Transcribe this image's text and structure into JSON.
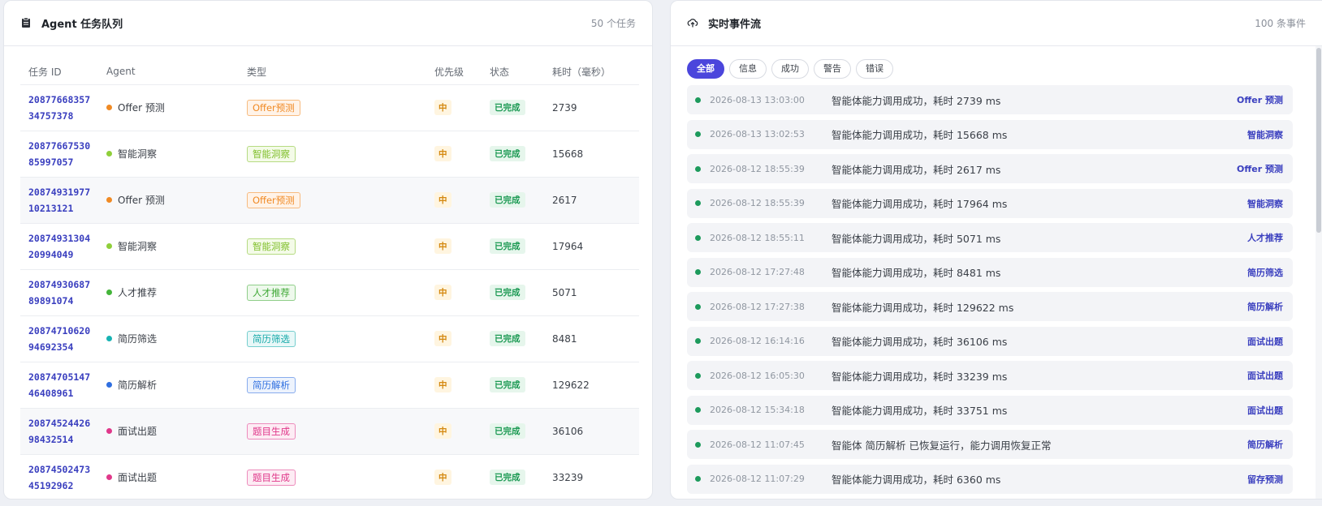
{
  "task_panel": {
    "title": "Agent 任务队列",
    "count": "50 个任务",
    "columns": [
      "任务 ID",
      "Agent",
      "类型",
      "优先级",
      "状态",
      "耗时（毫秒）"
    ],
    "rows": [
      {
        "id": "2087766835734757378",
        "agent": "Offer 预测",
        "agent_color": "#f08a24",
        "type": "Offer预测",
        "type_color": "#f08a24",
        "type_bg": "#fff3e8",
        "priority": "中",
        "status": "已完成",
        "duration": "2739"
      },
      {
        "id": "2087766753085997057",
        "agent": "智能洞察",
        "agent_color": "#8fcf3a",
        "type": "智能洞察",
        "type_color": "#7fbf2a",
        "type_bg": "#f4fbe8",
        "priority": "中",
        "status": "已完成",
        "duration": "15668"
      },
      {
        "id": "2087493197710213121",
        "agent": "Offer 预测",
        "agent_color": "#f08a24",
        "type": "Offer预测",
        "type_color": "#f08a24",
        "type_bg": "#fff3e8",
        "priority": "中",
        "status": "已完成",
        "duration": "2617"
      },
      {
        "id": "2087493130420994049",
        "agent": "智能洞察",
        "agent_color": "#8fcf3a",
        "type": "智能洞察",
        "type_color": "#7fbf2a",
        "type_bg": "#f4fbe8",
        "priority": "中",
        "status": "已完成",
        "duration": "17964"
      },
      {
        "id": "2087493068789891074",
        "agent": "人才推荐",
        "agent_color": "#44b53a",
        "type": "人才推荐",
        "type_color": "#3ea835",
        "type_bg": "#eef9ec",
        "priority": "中",
        "status": "已完成",
        "duration": "5071"
      },
      {
        "id": "2087471062094692354",
        "agent": "简历筛选",
        "agent_color": "#17b3b3",
        "type": "简历筛选",
        "type_color": "#13a8a8",
        "type_bg": "#e8f8f8",
        "priority": "中",
        "status": "已完成",
        "duration": "8481"
      },
      {
        "id": "2087470514746408961",
        "agent": "简历解析",
        "agent_color": "#2f6fe0",
        "type": "简历解析",
        "type_color": "#2f6fe0",
        "type_bg": "#edf3fd",
        "priority": "中",
        "status": "已完成",
        "duration": "129622"
      },
      {
        "id": "2087452442698432514",
        "agent": "面试出题",
        "agent_color": "#e0388a",
        "type": "题目生成",
        "type_color": "#e0388a",
        "type_bg": "#fdecf4",
        "priority": "中",
        "status": "已完成",
        "duration": "36106"
      },
      {
        "id": "2087450247345192962",
        "agent": "面试出题",
        "agent_color": "#e0388a",
        "type": "题目生成",
        "type_color": "#e0388a",
        "type_bg": "#fdecf4",
        "priority": "中",
        "status": "已完成",
        "duration": "33239"
      }
    ]
  },
  "event_panel": {
    "title": "实时事件流",
    "count": "100 条事件",
    "filters": [
      "全部",
      "信息",
      "成功",
      "警告",
      "错误"
    ],
    "events": [
      {
        "time": "2026-08-13 13:03:00",
        "message": "智能体能力调用成功，耗时 2739 ms",
        "source": "Offer 预测"
      },
      {
        "time": "2026-08-13 13:02:53",
        "message": "智能体能力调用成功，耗时 15668 ms",
        "source": "智能洞察"
      },
      {
        "time": "2026-08-12 18:55:39",
        "message": "智能体能力调用成功，耗时 2617 ms",
        "source": "Offer 预测"
      },
      {
        "time": "2026-08-12 18:55:39",
        "message": "智能体能力调用成功，耗时 17964 ms",
        "source": "智能洞察"
      },
      {
        "time": "2026-08-12 18:55:11",
        "message": "智能体能力调用成功，耗时 5071 ms",
        "source": "人才推荐"
      },
      {
        "time": "2026-08-12 17:27:48",
        "message": "智能体能力调用成功，耗时 8481 ms",
        "source": "简历筛选"
      },
      {
        "time": "2026-08-12 17:27:38",
        "message": "智能体能力调用成功，耗时 129622 ms",
        "source": "简历解析"
      },
      {
        "time": "2026-08-12 16:14:16",
        "message": "智能体能力调用成功，耗时 36106 ms",
        "source": "面试出题"
      },
      {
        "time": "2026-08-12 16:05:30",
        "message": "智能体能力调用成功，耗时 33239 ms",
        "source": "面试出题"
      },
      {
        "time": "2026-08-12 15:34:18",
        "message": "智能体能力调用成功，耗时 33751 ms",
        "source": "面试出题"
      },
      {
        "time": "2026-08-12 11:07:45",
        "message": "智能体 简历解析 已恢复运行，能力调用恢复正常",
        "source": "简历解析"
      },
      {
        "time": "2026-08-12 11:07:29",
        "message": "智能体能力调用成功，耗时 6360 ms",
        "source": "留存预测"
      }
    ]
  },
  "colors": {
    "accent": "#4b46dc",
    "link": "#3a3fbf",
    "success": "#1d9a54",
    "warning": "#d4880f"
  }
}
